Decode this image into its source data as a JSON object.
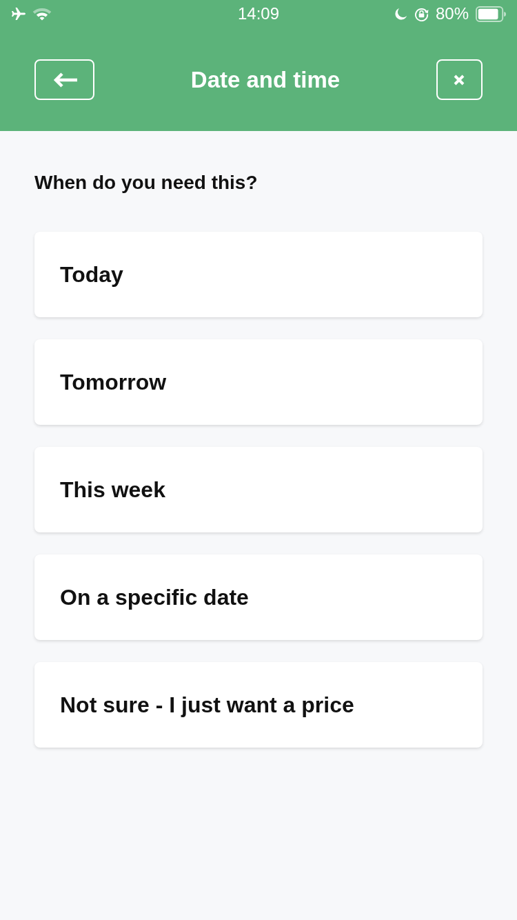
{
  "status_bar": {
    "time": "14:09",
    "battery": "80%"
  },
  "header": {
    "title": "Date and time"
  },
  "question": "When do you need this?",
  "options": [
    {
      "label": "Today"
    },
    {
      "label": "Tomorrow"
    },
    {
      "label": "This week"
    },
    {
      "label": "On a specific date"
    },
    {
      "label": "Not sure - I just want a price"
    }
  ]
}
